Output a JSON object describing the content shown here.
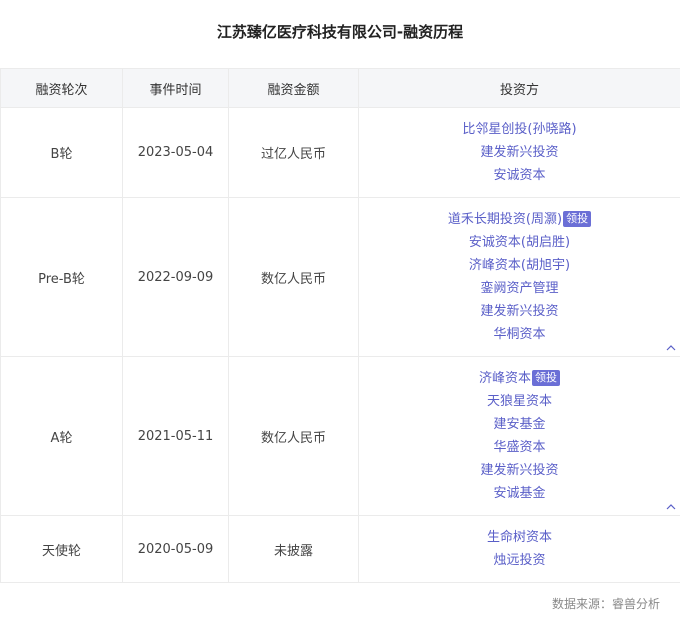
{
  "title": "江苏臻亿医疗科技有限公司-融资历程",
  "table": {
    "headers": [
      "融资轮次",
      "事件时间",
      "融资金额",
      "投资方"
    ],
    "lead_label": "领投",
    "rows": [
      {
        "round": "B轮",
        "date": "2023-05-04",
        "amount": "过亿人民币",
        "investors": [
          {
            "name": "比邻星创投(孙晓路)",
            "lead": false
          },
          {
            "name": "建发新兴投资",
            "lead": false
          },
          {
            "name": "安诚资本",
            "lead": false
          }
        ],
        "collapsible": false
      },
      {
        "round": "Pre-B轮",
        "date": "2022-09-09",
        "amount": "数亿人民币",
        "investors": [
          {
            "name": "道禾长期投资(周灏)",
            "lead": true
          },
          {
            "name": "安诚资本(胡启胜)",
            "lead": false
          },
          {
            "name": "济峰资本(胡旭宇)",
            "lead": false
          },
          {
            "name": "銮阙资产管理",
            "lead": false
          },
          {
            "name": "建发新兴投资",
            "lead": false
          },
          {
            "name": "华桐资本",
            "lead": false
          }
        ],
        "collapsible": true
      },
      {
        "round": "A轮",
        "date": "2021-05-11",
        "amount": "数亿人民币",
        "investors": [
          {
            "name": "济峰资本",
            "lead": true
          },
          {
            "name": "天狼星资本",
            "lead": false
          },
          {
            "name": "建安基金",
            "lead": false
          },
          {
            "name": "华盛资本",
            "lead": false
          },
          {
            "name": "建发新兴投资",
            "lead": false
          },
          {
            "name": "安诚基金",
            "lead": false
          }
        ],
        "collapsible": true
      },
      {
        "round": "天使轮",
        "date": "2020-05-09",
        "amount": "未披露",
        "investors": [
          {
            "name": "生命树资本",
            "lead": false
          },
          {
            "name": "烛远投资",
            "lead": false
          }
        ],
        "collapsible": false
      }
    ]
  },
  "source": "数据来源：睿兽分析",
  "colors": {
    "investor_link": "#5a5fc8",
    "lead_badge": "#6b6fd6",
    "header_bg": "#f5f6f8"
  },
  "icons": {
    "collapse": "chevron-up-icon"
  }
}
